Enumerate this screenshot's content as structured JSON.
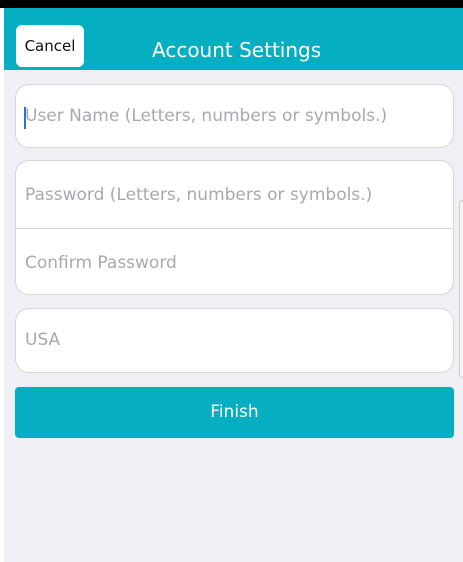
{
  "navbar": {
    "cancel_label": "Cancel",
    "title": "Account Settings",
    "color": "#05aec1"
  },
  "form": {
    "username": {
      "value": "",
      "placeholder": "User Name (Letters, numbers or symbols.)"
    },
    "password": {
      "value": "",
      "placeholder": "Password (Letters, numbers or symbols.)"
    },
    "confirm_password": {
      "value": "",
      "placeholder": "Confirm Password"
    },
    "country": {
      "value": "USA"
    }
  },
  "finish_label": "Finish",
  "colors": {
    "accent": "#05aec1",
    "background": "#f0eff4",
    "placeholder_text": "#a9a9ad",
    "caret": "#2d6ee0"
  }
}
